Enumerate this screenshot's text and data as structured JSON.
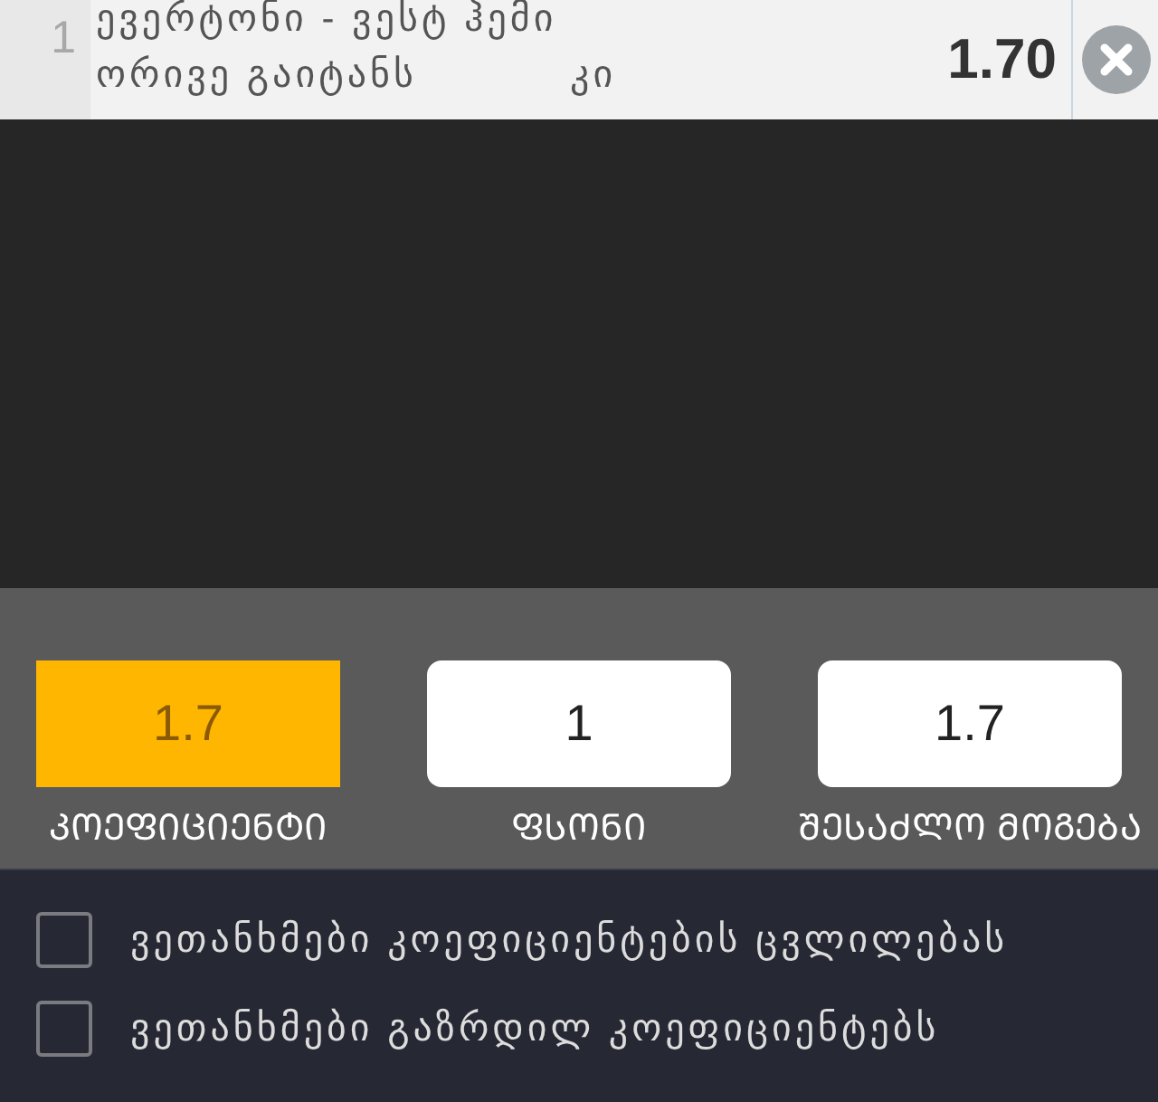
{
  "bet": {
    "number": "1",
    "match": "ევერტონი - ვესტ ჰემი",
    "market": "ორივე გაიტანს",
    "pick": "კი",
    "odds": "1.70"
  },
  "summary": [
    {
      "value": "1.7",
      "label": "ᲙᲝᲔᲤᲘᲪᲘᲔᲜᲢᲘ",
      "selected": true
    },
    {
      "value": "1",
      "label": "ᲤᲡᲝᲜᲘ",
      "selected": false
    },
    {
      "value": "1.7",
      "label": "ᲨᲔᲡᲐᲫᲚᲝ ᲛᲝᲒᲔᲑᲐ",
      "selected": false
    }
  ],
  "options": [
    {
      "label": "ვეთანხმები კოეფიციენტების ცვლილებას",
      "checked": false
    },
    {
      "label": "ვეთანხმები გაზრდილ კოეფიციენტებს",
      "checked": false
    }
  ]
}
